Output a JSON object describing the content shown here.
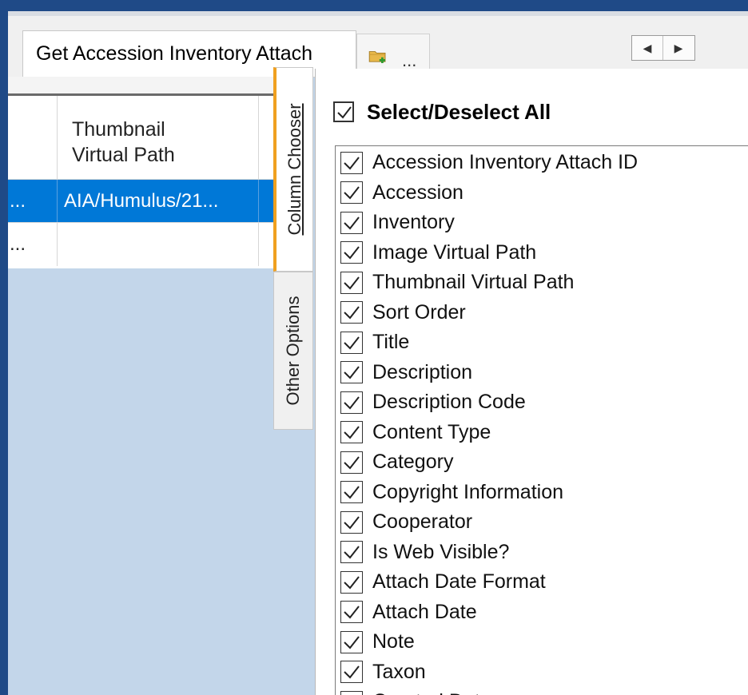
{
  "tabs": {
    "active_label": "Get Accession Inventory Attach",
    "new_tab_label": "..."
  },
  "icons": {
    "new_tab": "folder-add-icon",
    "scroll_left": "arrow-left-icon",
    "scroll_right": "arrow-right-icon",
    "checkbox": "checkmark-icon"
  },
  "grid": {
    "columns": [
      "",
      "Thumbnail\nVirtual Path",
      ""
    ],
    "rows": [
      [
        "...",
        "AIA/Humulus/21...",
        ""
      ],
      [
        "...",
        "",
        ""
      ]
    ]
  },
  "side_tabs": {
    "column_chooser": "Column Chooser",
    "other_options": "Other Options"
  },
  "column_chooser": {
    "select_all_label": "Select/Deselect All",
    "select_all_checked": true,
    "items": [
      {
        "label": "Accession Inventory Attach ID",
        "checked": true
      },
      {
        "label": "Accession",
        "checked": true
      },
      {
        "label": "Inventory",
        "checked": true
      },
      {
        "label": "Image Virtual Path",
        "checked": true
      },
      {
        "label": "Thumbnail Virtual Path",
        "checked": true
      },
      {
        "label": "Sort Order",
        "checked": true
      },
      {
        "label": "Title",
        "checked": true
      },
      {
        "label": "Description",
        "checked": true
      },
      {
        "label": "Description Code",
        "checked": true
      },
      {
        "label": "Content Type",
        "checked": true
      },
      {
        "label": "Category",
        "checked": true
      },
      {
        "label": "Copyright Information",
        "checked": true
      },
      {
        "label": "Cooperator",
        "checked": true
      },
      {
        "label": "Is Web Visible?",
        "checked": true
      },
      {
        "label": "Attach Date Format",
        "checked": true
      },
      {
        "label": "Attach Date",
        "checked": true
      },
      {
        "label": "Note",
        "checked": true
      },
      {
        "label": "Taxon",
        "checked": true
      },
      {
        "label": "Created Date",
        "checked": true
      }
    ]
  },
  "colors": {
    "window_border": "#1f4a87",
    "selection": "#0078d7",
    "active_tab_accent": "#f0a020",
    "background": "#c3d6ea"
  }
}
